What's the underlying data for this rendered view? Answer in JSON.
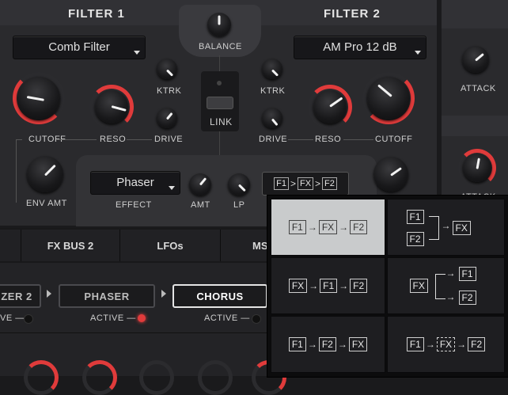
{
  "filter1": {
    "title": "FILTER 1",
    "type": "Comb Filter",
    "cutoff": "CUTOFF",
    "reso": "RESO",
    "drive": "DRIVE",
    "ktrk": "KTRK",
    "env_amt": "ENV AMT"
  },
  "filter2": {
    "title": "FILTER 2",
    "type": "AM Pro 12 dB",
    "cutoff": "CUTOFF",
    "reso": "RESO",
    "drive": "DRIVE",
    "ktrk": "KTRK"
  },
  "center": {
    "balance": "BALANCE",
    "link": "LINK"
  },
  "effect": {
    "value": "Phaser",
    "label": "EFFECT",
    "amt": "AMT",
    "lp": "LP",
    "routing": {
      "a": "F1",
      "b": "FX",
      "c": "F2"
    }
  },
  "right_panel": {
    "attack": "ATTACK",
    "attack2": "ATTACK"
  },
  "tabs": [
    "FX BUS 2",
    "LFOs",
    "MS"
  ],
  "fx_chain": {
    "items": [
      "ZER 2",
      "PHASER",
      "CHORUS"
    ],
    "active_label": "ACTIVE —",
    "active_partial": "VE —"
  },
  "routing_menu": [
    {
      "id": "f1-fx-f2",
      "selected": true
    },
    {
      "id": "f1-f2-parallel-fx",
      "selected": false
    },
    {
      "id": "fx-f1-f2",
      "selected": false
    },
    {
      "id": "fx-parallel-f1-f2",
      "selected": false
    },
    {
      "id": "f1-f2-fx",
      "selected": false
    },
    {
      "id": "f1-fx-f2-dashed",
      "selected": false
    }
  ],
  "labels": {
    "F1": "F1",
    "F2": "F2",
    "FX": "FX"
  },
  "colors": {
    "accent": "#e03b3b",
    "panel": "#2c2c2f",
    "selected_cell": "#c9cbcc"
  }
}
